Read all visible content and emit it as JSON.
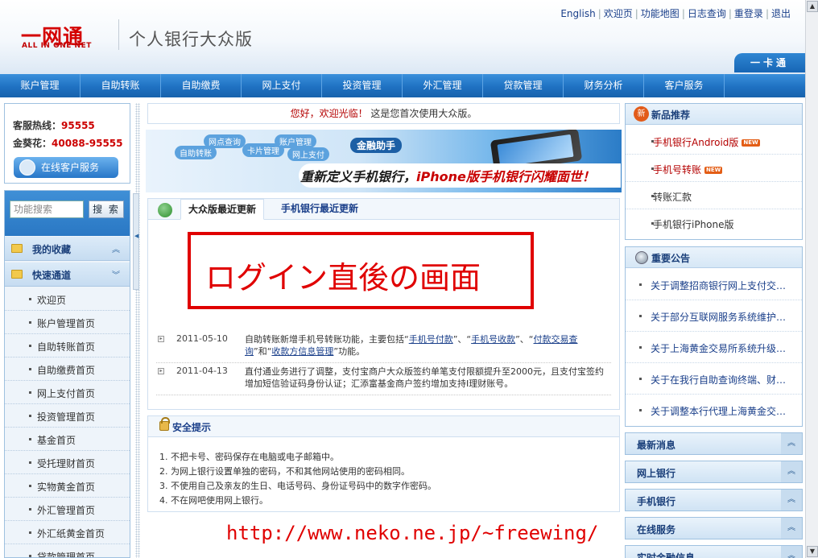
{
  "header": {
    "logo_cn": "一网通",
    "logo_en": "ALL IN ONE NET",
    "title": "个人银行大众版",
    "top_links": [
      "English",
      "欢迎页",
      "功能地图",
      "日志查询",
      "重登录",
      "退出"
    ],
    "card_tab": "一卡通"
  },
  "nav": {
    "items": [
      "账户管理",
      "自助转账",
      "自助缴费",
      "网上支付",
      "投资管理",
      "外汇管理",
      "贷款管理",
      "财务分析",
      "客户服务"
    ]
  },
  "hotline": {
    "service_label": "客服热线：",
    "service_number": "95555",
    "gold_label": "金葵花：",
    "gold_number": "40088-95555",
    "online_service": "在线客户服务"
  },
  "left_menu": {
    "search_placeholder": "功能搜索",
    "search_button": "搜 索",
    "favorites": "我的收藏",
    "quick": "快速通道",
    "items": [
      "欢迎页",
      "账户管理首页",
      "自助转账首页",
      "自助缴费首页",
      "网上支付首页",
      "投资管理首页",
      "基金首页",
      "受托理财首页",
      "实物黄金首页",
      "外汇管理首页",
      "外汇纸黄金首页",
      "贷款管理首页"
    ]
  },
  "welcome": {
    "greeting": "您好，欢迎光临！",
    "message": "这是您首次使用大众版。"
  },
  "banner": {
    "bubbles": [
      "自助转账",
      "网点查询",
      "卡片管理",
      "账户管理",
      "网上支付"
    ],
    "helper": "金融助手",
    "slogan_a": "重新定义手机银行，",
    "slogan_b": "iPhone版手机银行闪耀面世！"
  },
  "updates": {
    "tab_active": "大众版最近更新",
    "tab_other": "手机银行最近更新",
    "rows": [
      {
        "date": "2011-05-10",
        "t1": "自助转账新增手机号转账功能，主要包括“",
        "l1": "手机号付款",
        "t2": "”、“",
        "l2": "手机号收款",
        "t3": "”、“",
        "l3": "付款交易查询",
        "t4": "”和“",
        "l4": "收款方信息管理",
        "t5": "”功能。"
      },
      {
        "date": "2011-04-13",
        "text": "直付通业务进行了调整，支付宝商户大众版签约单笔支付限额提升至2000元，且支付宝签约增加短信验证码身份认证；汇添富基金商户签约增加支持I理财账号。"
      }
    ]
  },
  "overlay": "ログイン直後の画面",
  "safety": {
    "title": "安全提示",
    "items": [
      "1. 不把卡号、密码保存在电脑或电子邮箱中。",
      "2. 为网上银行设置单独的密码，不和其他网站使用的密码相同。",
      "3. 不使用自己及亲友的生日、电话号码、身份证号码中的数字作密码。",
      "4. 不在网吧使用网上银行。"
    ]
  },
  "watermark_url": "http://www.neko.ne.jp/~freewing/",
  "right": {
    "new_products_badge": "新",
    "new_products_title": "新品推荐",
    "products": [
      "手机银行Android版",
      "手机号转账",
      "转账汇款",
      "手机银行iPhone版"
    ],
    "new_tag": "NEW",
    "announce_title": "重要公告",
    "announcements": [
      "关于调整招商银行网上支付交…",
      "关于部分互联网服务系统维护…",
      "关于上海黄金交易所系统升级…",
      "关于在我行自助查询终端、财…",
      "关于调整本行代理上海黄金交…"
    ],
    "bars": [
      "最新消息",
      "网上银行",
      "手机银行",
      "在线服务",
      "实时金融信息"
    ]
  },
  "colors": {
    "nav_blue": "#1f71c2",
    "brand_red": "#d40000",
    "overlay_red": "#e00000"
  }
}
